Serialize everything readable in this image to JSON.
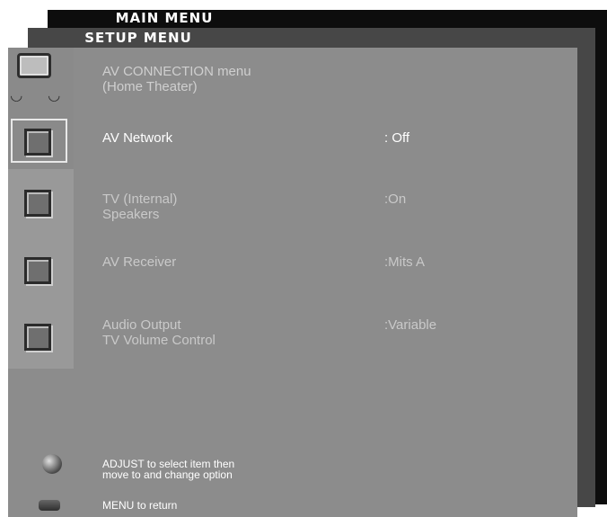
{
  "main_menu": {
    "title": "MAIN MENU"
  },
  "setup_menu": {
    "title": "SETUP MENU"
  },
  "av_menu": {
    "header": {
      "line1": "AV CONNECTION menu",
      "line2": "(Home Theater)"
    },
    "items": [
      {
        "label1": "AV Network",
        "label2": "",
        "value": ": Off"
      },
      {
        "label1": "TV (Internal)",
        "label2": "Speakers",
        "value": ":On"
      },
      {
        "label1": "AV Receiver",
        "label2": "",
        "value": ":Mits A"
      },
      {
        "label1": "Audio Output",
        "label2": "TV Volume Control",
        "value": ":Variable"
      }
    ],
    "hints": {
      "adjust_line1": "ADJUST to select item then",
      "adjust_line2": "move to and change option",
      "menu": "MENU to return"
    }
  },
  "icons": [
    "tv-speakers-icon",
    "square-icon",
    "adjust-knob-icon",
    "menu-button-icon"
  ]
}
